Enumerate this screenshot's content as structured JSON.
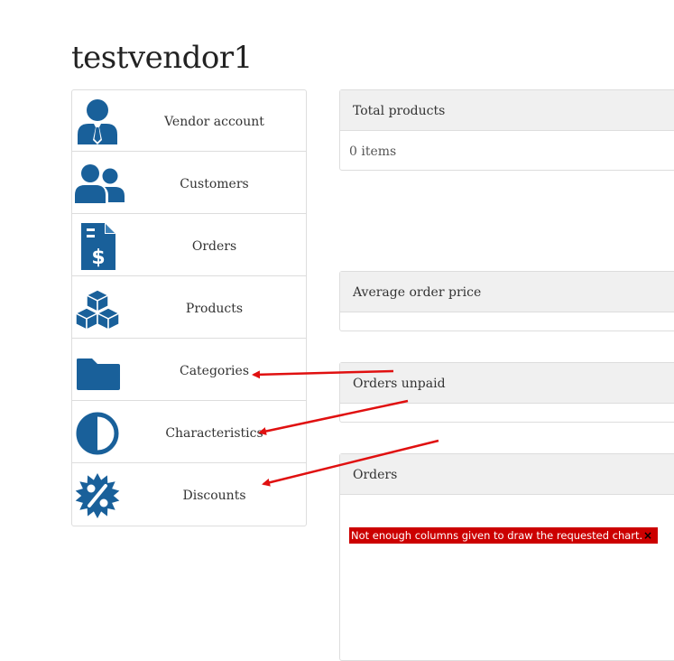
{
  "page": {
    "title": "testvendor1"
  },
  "menu": {
    "items": [
      {
        "label": "Vendor account",
        "icon": "vendor-user-icon"
      },
      {
        "label": "Customers",
        "icon": "customers-icon"
      },
      {
        "label": "Orders",
        "icon": "invoice-dollar-icon"
      },
      {
        "label": "Products",
        "icon": "boxes-icon"
      },
      {
        "label": "Categories",
        "icon": "folder-icon"
      },
      {
        "label": "Characteristics",
        "icon": "half-circle-icon"
      },
      {
        "label": "Discounts",
        "icon": "percent-badge-icon"
      }
    ]
  },
  "panels": {
    "total_products": {
      "heading": "Total products",
      "value": "0 items"
    },
    "average_order_price": {
      "heading": "Average order price",
      "value": ""
    },
    "orders_unpaid": {
      "heading": "Orders unpaid",
      "value": ""
    },
    "orders": {
      "heading": "Orders",
      "chart_error": "Not enough columns given to draw the requested chart.",
      "chart_error_close": "×"
    }
  },
  "colors": {
    "icon_blue": "#19609a",
    "annotation_arrow": "#e01010",
    "error_bg": "#cc0000",
    "panel_heading_bg": "#f0f0f0",
    "border": "#dddddd"
  }
}
